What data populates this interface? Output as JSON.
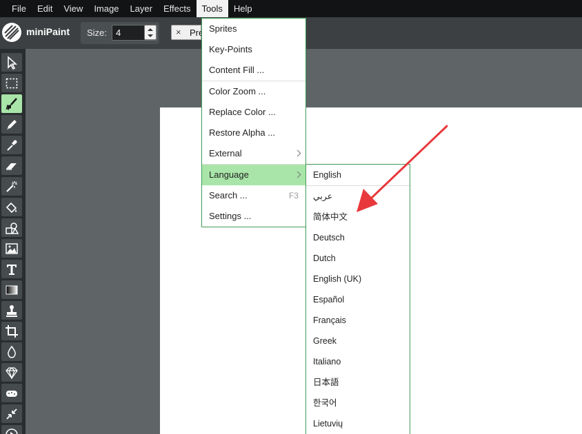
{
  "menubar": {
    "items": [
      {
        "label": "File"
      },
      {
        "label": "Edit"
      },
      {
        "label": "View"
      },
      {
        "label": "Image"
      },
      {
        "label": "Layer"
      },
      {
        "label": "Effects"
      },
      {
        "label": "Tools"
      },
      {
        "label": "Help"
      }
    ]
  },
  "toolbar": {
    "app_name": "miniPaint",
    "size_label": "Size:",
    "size_value": "4",
    "pre_close": "×",
    "pre_label": "Pre"
  },
  "tools_menu": {
    "items": [
      {
        "label": "Sprites"
      },
      {
        "label": "Key-Points"
      },
      {
        "label": "Content Fill ..."
      },
      {
        "label": "Color Zoom ..."
      },
      {
        "label": "Replace Color ..."
      },
      {
        "label": "Restore Alpha ..."
      },
      {
        "label": "External"
      },
      {
        "label": "Language"
      },
      {
        "label": "Search ...",
        "shortcut": "F3"
      },
      {
        "label": "Settings ..."
      }
    ]
  },
  "language_menu": {
    "items": [
      {
        "label": "English"
      },
      {
        "label": "عربي"
      },
      {
        "label": "简体中文"
      },
      {
        "label": "Deutsch"
      },
      {
        "label": "Dutch"
      },
      {
        "label": "English (UK)"
      },
      {
        "label": "Español"
      },
      {
        "label": "Français"
      },
      {
        "label": "Greek"
      },
      {
        "label": "Italiano"
      },
      {
        "label": "日本語"
      },
      {
        "label": "한국어"
      },
      {
        "label": "Lietuvių"
      }
    ]
  },
  "tool_icons": [
    "select-icon",
    "selection-icon",
    "brush-icon",
    "pencil-icon",
    "pick-color-icon",
    "erase-icon",
    "magic-wand-icon",
    "fill-icon",
    "shape-icon",
    "media-icon",
    "text-icon",
    "gradient-icon",
    "clone-icon",
    "crop-icon",
    "blur-icon",
    "sharpen-icon",
    "desaturate-icon",
    "bulge-icon",
    "animation-icon"
  ],
  "colors": {
    "accent": "#a9e5a9",
    "menu_border": "#3f9a52",
    "menubar_bg": "#111314",
    "annotation_arrow": "#e8383c"
  }
}
